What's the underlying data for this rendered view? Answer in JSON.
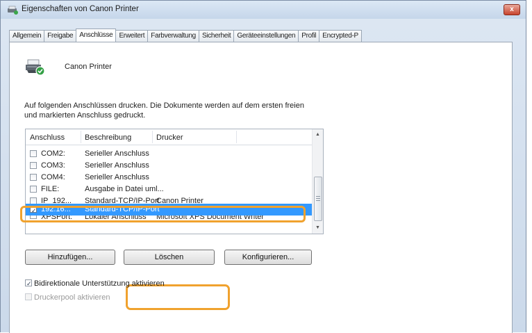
{
  "window": {
    "title": "Eigenschaften von Canon Printer",
    "close_symbol": "x"
  },
  "tabs": [
    {
      "label": "Allgemein",
      "active": false
    },
    {
      "label": "Freigabe",
      "active": false
    },
    {
      "label": "Anschlüsse",
      "active": true
    },
    {
      "label": "Erweitert",
      "active": false
    },
    {
      "label": "Farbverwaltung",
      "active": false
    },
    {
      "label": "Sicherheit",
      "active": false
    },
    {
      "label": "Geräteeinstellungen",
      "active": false
    },
    {
      "label": "Profil",
      "active": false
    },
    {
      "label": "Encrypted-P",
      "active": false
    }
  ],
  "printer": {
    "name": "Canon Printer",
    "icon": "printer-with-check-icon"
  },
  "description": "Auf folgenden Anschlüssen drucken. Die Dokumente werden auf dem ersten freien und markierten Anschluss gedruckt.",
  "ports": {
    "headers": [
      "Anschluss",
      "Beschreibung",
      "Drucker"
    ],
    "rows": [
      {
        "port": "COM2:",
        "description": "Serieller Anschluss",
        "printer": "",
        "checked": false,
        "selected": false
      },
      {
        "port": "COM3:",
        "description": "Serieller Anschluss",
        "printer": "",
        "checked": false,
        "selected": false
      },
      {
        "port": "COM4:",
        "description": "Serieller Anschluss",
        "printer": "",
        "checked": false,
        "selected": false
      },
      {
        "port": "FILE:",
        "description": "Ausgabe in Datei uml...",
        "printer": "",
        "checked": false,
        "selected": false
      },
      {
        "port": "IP_192...",
        "description": "Standard-TCP/IP-Port",
        "printer": "Canon Printer",
        "checked": false,
        "selected": false
      },
      {
        "port": "192.16...",
        "description": "Standard-TCP/IP-Port",
        "printer": "",
        "checked": true,
        "selected": true
      },
      {
        "port": "XPSPort:",
        "description": "Lokaler Anschluss",
        "printer": "Microsoft XPS Document Writer",
        "checked": false,
        "selected": false
      }
    ]
  },
  "buttons": {
    "add": "Hinzufügen...",
    "delete": "Löschen",
    "configure": "Konfigurieren..."
  },
  "options": {
    "bidirectional": {
      "label": "Bidirektionale Unterstützung aktivieren",
      "checked": true,
      "enabled": true
    },
    "pool": {
      "label": "Druckerpool aktivieren",
      "checked": false,
      "enabled": false
    }
  },
  "colors": {
    "selection": "#3399ff",
    "highlight": "#f0a22e"
  }
}
